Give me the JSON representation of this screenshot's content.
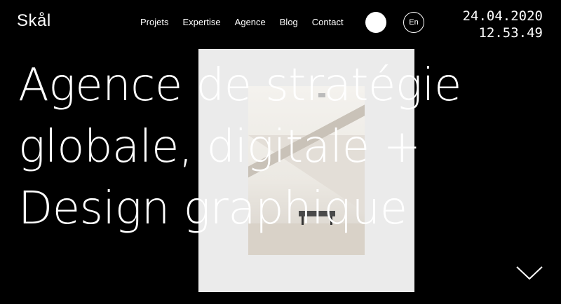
{
  "brand": {
    "logo": "Skål"
  },
  "nav": [
    {
      "label": "Projets"
    },
    {
      "label": "Expertise"
    },
    {
      "label": "Agence"
    },
    {
      "label": "Blog"
    },
    {
      "label": "Contact"
    }
  ],
  "lang": {
    "label": "En"
  },
  "clock": {
    "date": "24.04.2020",
    "time": "12.53.49"
  },
  "hero": {
    "line1": "Agence de stratégie",
    "line2": "globale, digitale +",
    "line3": "Design graphique"
  },
  "icons": {
    "scroll": "chevron-down-icon",
    "theme": "circle-toggle-icon"
  },
  "colors": {
    "background": "#000000",
    "text": "#ffffff",
    "card": "#ebebeb"
  }
}
